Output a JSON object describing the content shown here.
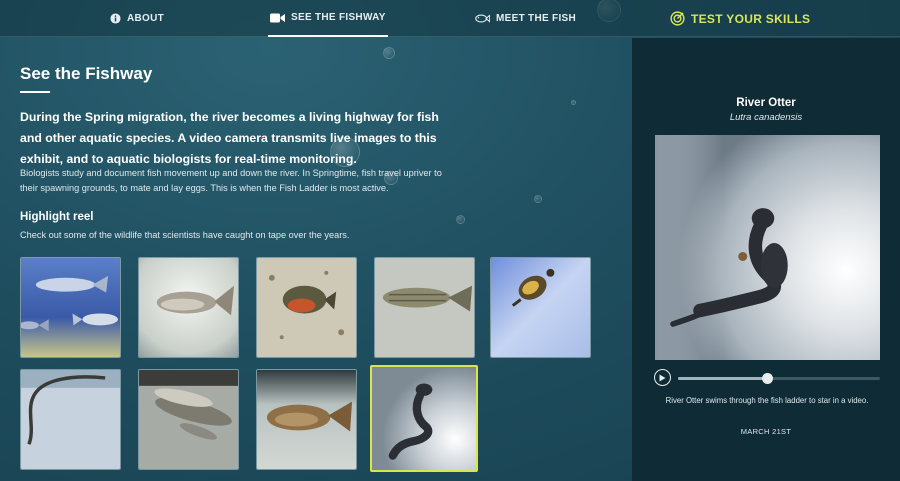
{
  "nav": {
    "about": "ABOUT",
    "fishway": "SEE THE FISHWAY",
    "meet": "MEET THE FISH",
    "skills": "TEST YOUR SKILLS",
    "active": "fishway",
    "skills_color": "#d7e65a"
  },
  "main": {
    "title": "See the Fishway",
    "lead": "During the Spring migration, the river becomes a living highway for fish and other aquatic species. A video camera transmits live images to this exhibit, and to aquatic biologists for real-time monitoring.",
    "body": "Biologists study and document fish movement up and down the river. In Springtime, fish travel upriver to their spawning grounds, to mate and lay eggs. This is when the Fish Ladder is most active.",
    "reel_title": "Highlight reel",
    "reel_subtitle": "Check out some of the wildlife that scientists have caught on tape over the years.",
    "thumbnails": [
      {
        "subject": "school-of-fish",
        "selected": false
      },
      {
        "subject": "silver-fish",
        "selected": false
      },
      {
        "subject": "sunfish",
        "selected": false
      },
      {
        "subject": "striped-fish",
        "selected": false
      },
      {
        "subject": "turtle",
        "selected": false
      },
      {
        "subject": "eel",
        "selected": false
      },
      {
        "subject": "fish-group-dark",
        "selected": false
      },
      {
        "subject": "carp",
        "selected": false
      },
      {
        "subject": "river-otter",
        "selected": true
      }
    ]
  },
  "panel": {
    "name": "River Otter",
    "latin": "Lutra canadensis",
    "progress": 0.44,
    "caption": "River Otter swims through the fish ladder to star in a video.",
    "date": "MARCH 21ST"
  },
  "colors": {
    "accent": "#d9e64a",
    "panel_bg": "#0f2b35",
    "page_bg": "#1e4d5c"
  }
}
